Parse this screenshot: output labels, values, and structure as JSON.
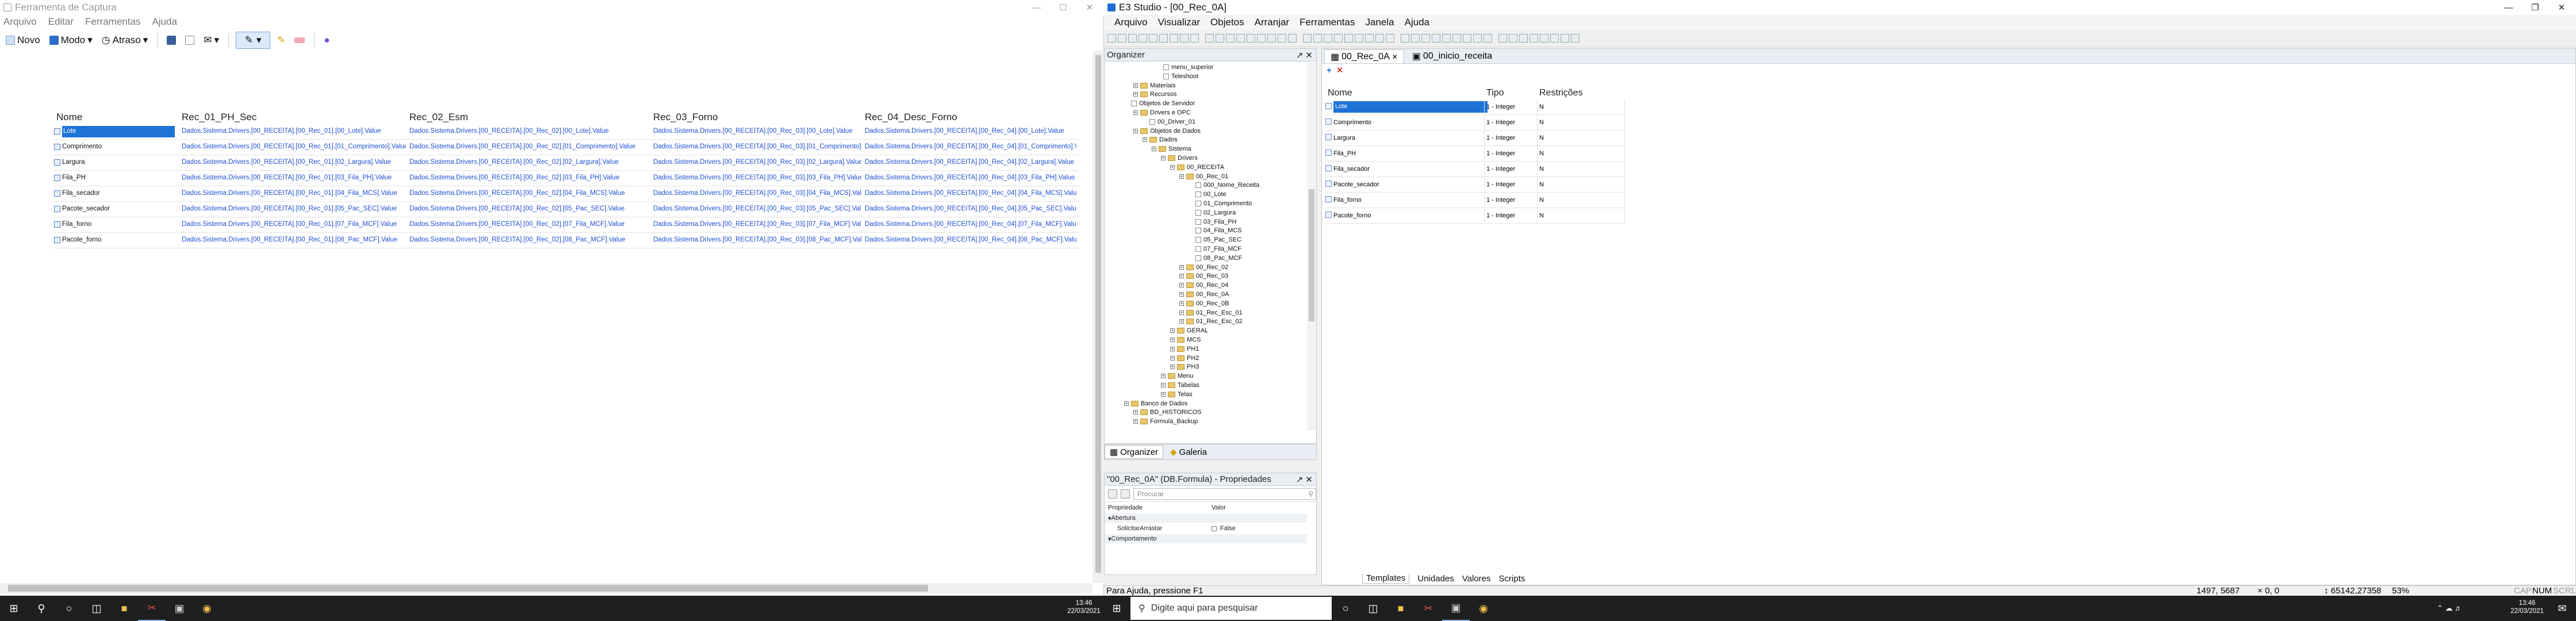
{
  "snip": {
    "title": "Ferramenta de Captura",
    "menu": [
      "Arquivo",
      "Editar",
      "Ferramentas",
      "Ajuda"
    ],
    "toolbar": {
      "new": "Novo",
      "mode": "Modo",
      "delay": "Atraso"
    },
    "grid": {
      "headers": [
        "Nome",
        "Rec_01_PH_Sec",
        "Rec_02_Esm",
        "Rec_03_Forno",
        "Rec_04_Desc_Forno"
      ],
      "rows": [
        {
          "name": "Lote",
          "c1": "Dados.Sistema.Drivers.[00_RECEITA].[00_Rec_01].[00_Lote].Value",
          "c2": "Dados.Sistema.Drivers.[00_RECEITA].[00_Rec_02].[00_Lote].Value",
          "c3": "Dados.Sistema.Drivers.[00_RECEITA].[00_Rec_03].[00_Lote].Value",
          "c4": "Dados.Sistema.Drivers.[00_RECEITA].[00_Rec_04].[00_Lote].Value"
        },
        {
          "name": "Comprimento",
          "c1": "Dados.Sistema.Drivers.[00_RECEITA].[00_Rec_01].[01_Comprimento].Value",
          "c2": "Dados.Sistema.Drivers.[00_RECEITA].[00_Rec_02].[01_Comprimento].Value",
          "c3": "Dados.Sistema.Drivers.[00_RECEITA].[00_Rec_03].[01_Comprimento].Val",
          "c4": "Dados.Sistema.Drivers.[00_RECEITA].[00_Rec_04].[01_Comprimento].Value"
        },
        {
          "name": "Largura",
          "c1": "Dados.Sistema.Drivers.[00_RECEITA].[00_Rec_01].[02_Largura].Value",
          "c2": "Dados.Sistema.Drivers.[00_RECEITA].[00_Rec_02].[02_Largura].Value",
          "c3": "Dados.Sistema.Drivers.[00_RECEITA].[00_Rec_03].[02_Largura].Value",
          "c4": "Dados.Sistema.Drivers.[00_RECEITA].[00_Rec_04].[02_Largura].Value"
        },
        {
          "name": "Fila_PH",
          "c1": "Dados.Sistema.Drivers.[00_RECEITA].[00_Rec_01].[03_Fila_PH].Value",
          "c2": "Dados.Sistema.Drivers.[00_RECEITA].[00_Rec_02].[03_Fila_PH].Value",
          "c3": "Dados.Sistema.Drivers.[00_RECEITA].[00_Rec_03].[03_Fila_PH].Value",
          "c4": "Dados.Sistema.Drivers.[00_RECEITA].[00_Rec_04].[03_Fila_PH].Value"
        },
        {
          "name": "Fila_secador",
          "c1": "Dados.Sistema.Drivers.[00_RECEITA].[00_Rec_01].[04_Fila_MCS].Value",
          "c2": "Dados.Sistema.Drivers.[00_RECEITA].[00_Rec_02].[04_Fila_MCS].Value",
          "c3": "Dados.Sistema.Drivers.[00_RECEITA].[00_Rec_03].[04_Fila_MCS].Value",
          "c4": "Dados.Sistema.Drivers.[00_RECEITA].[00_Rec_04].[04_Fila_MCS].Value"
        },
        {
          "name": "Pacote_secador",
          "c1": "Dados.Sistema.Drivers.[00_RECEITA].[00_Rec_01].[05_Pac_SEC].Value",
          "c2": "Dados.Sistema.Drivers.[00_RECEITA].[00_Rec_02].[05_Pac_SEC].Value",
          "c3": "Dados.Sistema.Drivers.[00_RECEITA].[00_Rec_03].[05_Pac_SEC].Value",
          "c4": "Dados.Sistema.Drivers.[00_RECEITA].[00_Rec_04].[05_Pac_SEC].Value"
        },
        {
          "name": "Fila_forno",
          "c1": "Dados.Sistema.Drivers.[00_RECEITA].[00_Rec_01].[07_Fila_MCF].Value",
          "c2": "Dados.Sistema.Drivers.[00_RECEITA].[00_Rec_02].[07_Fila_MCF].Value",
          "c3": "Dados.Sistema.Drivers.[00_RECEITA].[00_Rec_03].[07_Fila_MCF].Value",
          "c4": "Dados.Sistema.Drivers.[00_RECEITA].[00_Rec_04].[07_Fila_MCF].Value"
        },
        {
          "name": "Pacote_forno",
          "c1": "Dados.Sistema.Drivers.[00_RECEITA].[00_Rec_01].[08_Pac_MCF].Value",
          "c2": "Dados.Sistema.Drivers.[00_RECEITA].[00_Rec_02].[08_Pac_MCF].Value",
          "c3": "Dados.Sistema.Drivers.[00_RECEITA].[00_Rec_03].[08_Pac_MCF].Value",
          "c4": "Dados.Sistema.Drivers.[00_RECEITA].[00_Rec_04].[08_Pac_MCF].Value"
        }
      ]
    }
  },
  "e3": {
    "title": "E3 Studio - [00_Rec_0A]",
    "menu": [
      "Arquivo",
      "Visualizar",
      "Objetos",
      "Arranjar",
      "Ferramentas",
      "Janela",
      "Ajuda"
    ],
    "organizer": {
      "title": "Organizer",
      "tree": [
        "menu_superior",
        "Teleshoot",
        "Materiais",
        "Recursos",
        "Objetos de Servidor",
        "Drivers e OPC",
        "00_Driver_01",
        "Objetos de Dados",
        "Dados",
        "Sistema",
        "Drivers",
        "00_RECEITA",
        "00_Rec_01",
        "000_Nome_Receita",
        "00_Lote",
        "01_Comprimento",
        "02_Largura",
        "03_Fila_PH",
        "04_Fila_MCS",
        "05_Pac_SEC",
        "07_Fila_MCF",
        "08_Pac_MCF",
        "00_Rec_02",
        "00_Rec_03",
        "00_Rec_04",
        "00_Rec_0A",
        "00_Rec_0B",
        "01_Rec_Esc_01",
        "01_Rec_Esc_02",
        "GERAL",
        "MCS",
        "PH1",
        "PH2",
        "PH3",
        "Menu",
        "Tabelas",
        "Telas",
        "Banco de Dados",
        "BD_HISTORICOS",
        "Formula_Backup"
      ],
      "tabs": [
        "Organizer",
        "Galeria"
      ]
    },
    "properties": {
      "title": "\"00_Rec_0A\" (DB.Formula) - Propriedades",
      "search": "Procurar",
      "col_prop": "Propriedade",
      "col_val": "Valor",
      "group1": "Abertura",
      "row_name": "SolicitarArrastar",
      "row_val": "False",
      "group2": "Comportamento"
    },
    "doc": {
      "tabs": [
        "00_Rec_0A",
        "00_inicio_receita"
      ],
      "headers": [
        "Nome",
        "Tipo",
        "Restrições"
      ],
      "rows": [
        {
          "name": "Lote",
          "type": "1 - Integer",
          "r": "N"
        },
        {
          "name": "Comprimento",
          "type": "1 - Integer",
          "r": "N"
        },
        {
          "name": "Largura",
          "type": "1 - Integer",
          "r": "N"
        },
        {
          "name": "Fila_PH",
          "type": "1 - Integer",
          "r": "N"
        },
        {
          "name": "Fila_secador",
          "type": "1 - Integer",
          "r": "N"
        },
        {
          "name": "Pacote_secador",
          "type": "1 - Integer",
          "r": "N"
        },
        {
          "name": "Fila_forno",
          "type": "1 - Integer",
          "r": "N"
        },
        {
          "name": "Pacote_forno",
          "type": "1 - Integer",
          "r": "N"
        }
      ],
      "bottom_tabs": [
        "Templates",
        "Unidades",
        "Valores",
        "Scripts"
      ]
    },
    "status": {
      "help": "Para Ajuda, pressione F1",
      "coords": "1497, 5687",
      "zero": "0, 0",
      "coord2": "65142,27358",
      "zoom": "53%",
      "caps": "CAP",
      "num": "NUM",
      "scrl": "SCRL"
    }
  },
  "taskbar": {
    "search_placeholder": "Digite aqui para pesquisar",
    "time": "13:46",
    "date": "22/03/2021"
  }
}
